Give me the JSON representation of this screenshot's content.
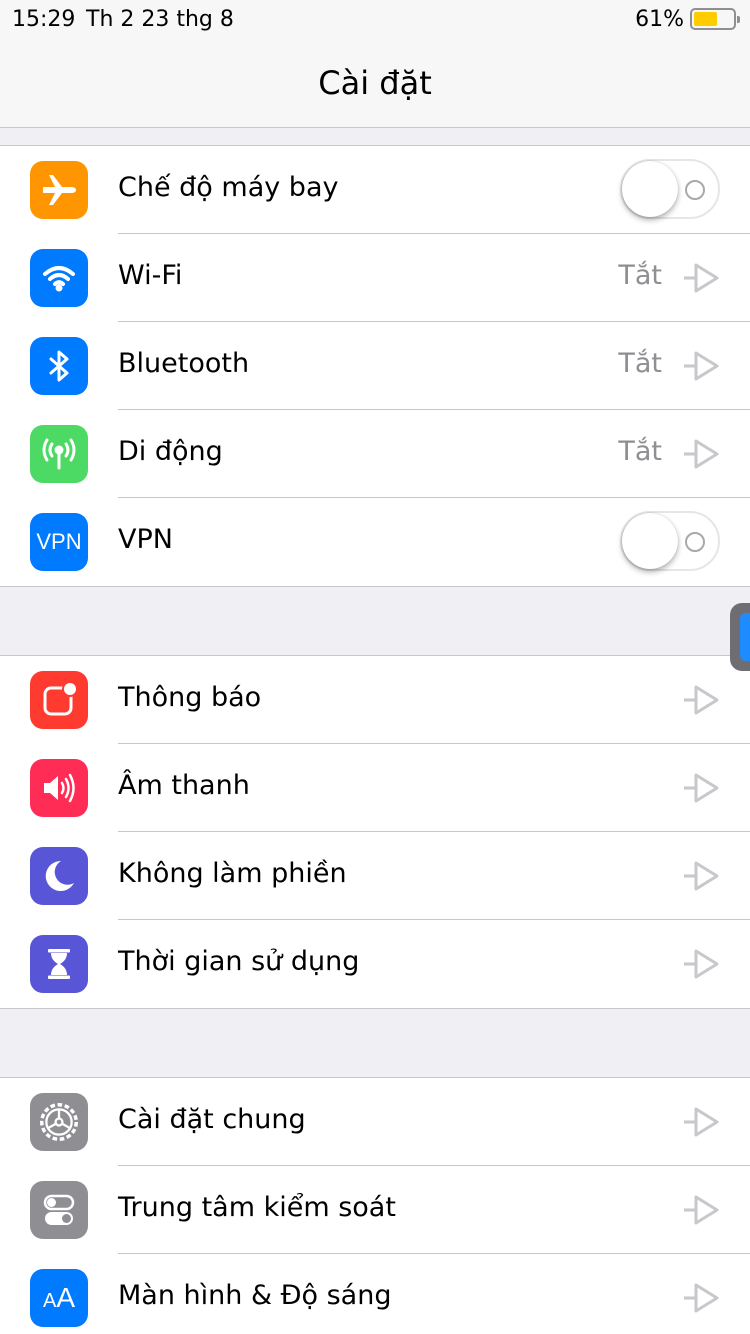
{
  "status_bar": {
    "time": "15:29",
    "date": "Th 2 23 thg 8",
    "battery_percent": "61%",
    "battery_level": 0.61,
    "battery_color": "#ffcc00"
  },
  "nav": {
    "title": "Cài đặt"
  },
  "groups": [
    {
      "items": [
        {
          "label": "Chế độ máy bay",
          "icon": "airplane-icon",
          "icon_color": "#ff9500",
          "accessory": "toggle",
          "toggle_on": false
        },
        {
          "label": "Wi-Fi",
          "icon": "wifi-icon",
          "icon_color": "#007aff",
          "accessory": "value",
          "value": "Tắt"
        },
        {
          "label": "Bluetooth",
          "icon": "bluetooth-icon",
          "icon_color": "#007aff",
          "accessory": "value",
          "value": "Tắt"
        },
        {
          "label": "Di động",
          "icon": "cellular-antenna-icon",
          "icon_color": "#4cd964",
          "accessory": "value",
          "value": "Tắt"
        },
        {
          "label": "VPN",
          "icon": "vpn-icon",
          "icon_text": "VPN",
          "icon_color": "#007aff",
          "accessory": "toggle",
          "toggle_on": false
        }
      ]
    },
    {
      "items": [
        {
          "label": "Thông báo",
          "icon": "notifications-icon",
          "icon_color": "#ff3b30",
          "accessory": "chevron"
        },
        {
          "label": "Âm thanh",
          "icon": "speaker-icon",
          "icon_color": "#ff2d55",
          "accessory": "chevron"
        },
        {
          "label": "Không làm phiền",
          "icon": "moon-icon",
          "icon_color": "#5856d6",
          "accessory": "chevron"
        },
        {
          "label": "Thời gian sử dụng",
          "icon": "hourglass-icon",
          "icon_color": "#5856d6",
          "accessory": "chevron"
        }
      ]
    },
    {
      "items": [
        {
          "label": "Cài đặt chung",
          "icon": "gear-icon",
          "icon_color": "#8e8e93",
          "accessory": "chevron"
        },
        {
          "label": "Trung tâm kiểm soát",
          "icon": "switches-icon",
          "icon_color": "#8e8e93",
          "accessory": "chevron"
        },
        {
          "label": "Màn hình & Độ sáng",
          "icon": "text-size-icon",
          "icon_text": "AA",
          "icon_color": "#007aff",
          "accessory": "chevron"
        }
      ]
    }
  ]
}
